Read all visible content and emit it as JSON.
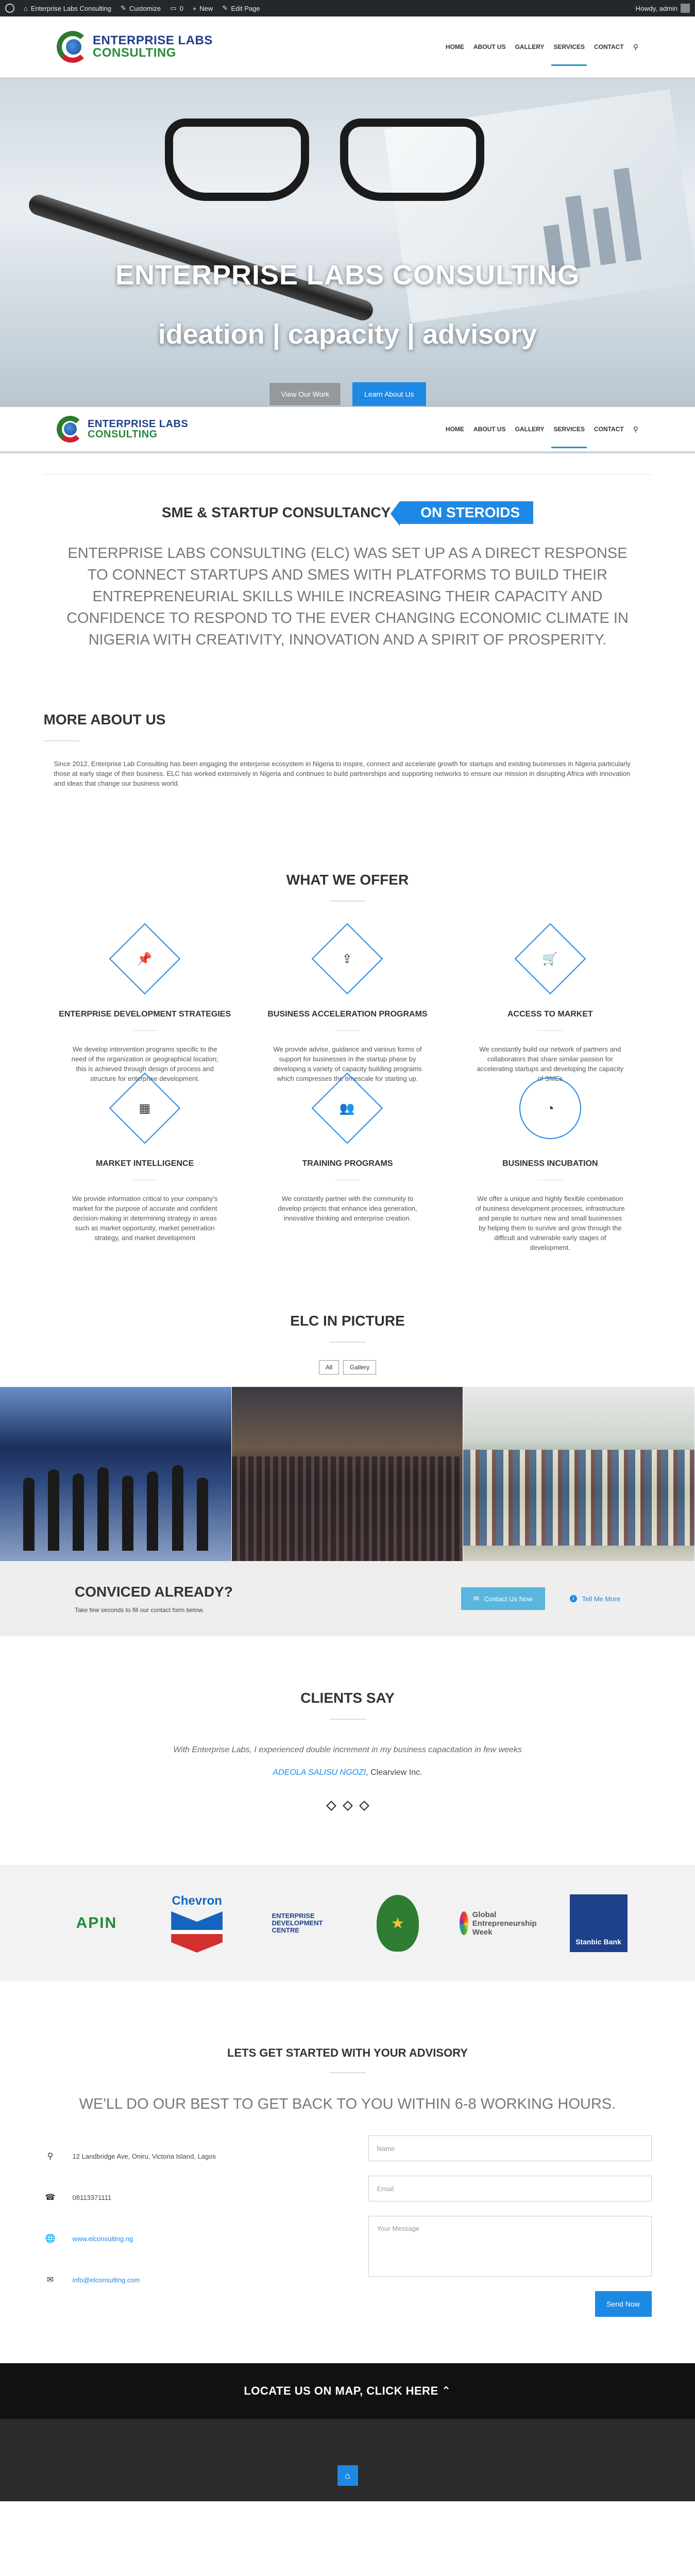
{
  "adminbar": {
    "site": "Enterprise Labs Consulting",
    "customize": "Customize",
    "comments": "0",
    "new": "New",
    "edit": "Edit Page",
    "howdy": "Howdy, admin"
  },
  "header": {
    "logo_line1": "ENTERPRISE LABS",
    "logo_line2": "CONSULTING",
    "nav": [
      "HOME",
      "ABOUT US",
      "GALLERY",
      "SERVICES",
      "CONTACT"
    ],
    "active": "SERVICES"
  },
  "hero": {
    "title": "ENTERPRISE LABS CONSULTING",
    "subtitle": "ideation | capacity | advisory",
    "btn_work": "View Our Work",
    "btn_about": "Learn About Us"
  },
  "steroids": {
    "text": "SME & STARTUP CONSULTANCY",
    "tag": "ON STEROIDS"
  },
  "intro": "ENTERPRISE LABS CONSULTING (ELC) WAS SET UP AS A DIRECT RESPONSE TO CONNECT STARTUPS AND SMES WITH PLATFORMS TO BUILD THEIR ENTREPRENEURIAL SKILLS WHILE INCREASING THEIR CAPACITY AND CONFIDENCE TO RESPOND TO THE EVER CHANGING ECONOMIC CLIMATE IN NIGERIA WITH CREATIVITY, INNOVATION AND A SPIRIT OF PROSPERITY.",
  "about": {
    "title": "MORE ABOUT US",
    "text": "Since 2012, Enterprise Lab Consulting has been engaging the enterprise ecosystem in Nigeria to inspire, connect and accelerate growth for startups and existing businesses in Nigeria particularly those at early stage of their business. ELC has worked extensively in Nigeria and continues to build partnerships and supporting networks to ensure our mission in disrupting Africa with innovation and ideas that change our business world."
  },
  "offer": {
    "title": "WHAT WE OFFER",
    "items": [
      {
        "icon": "pin-icon",
        "title": "ENTERPRISE DEVELOPMENT STRATEGIES",
        "text": "We develop intervention programs specific to the need of the organization or geographical location; this is achieved through design of process and structure for enterprise development."
      },
      {
        "icon": "upload-icon",
        "title": "BUSINESS ACCELERATION PROGRAMS",
        "text": "We provide advise, guidance and various forms of support for businesses in the startup phase by developing a variety of capacity building programs which compresses the timescale for starting up."
      },
      {
        "icon": "cart-icon",
        "title": "ACCESS TO MARKET",
        "text": "We constantly build our network of partners and collaborators that share similar passion for accelerating startups and developing the capacity of SMEs"
      },
      {
        "icon": "calendar-icon",
        "title": "MARKET INTELLIGENCE",
        "text": "We provide information critical to your company's market for the purpose of accurate and confident decision-making in determining strategy in areas such as market opportunity, market penetration strategy, and market development"
      },
      {
        "icon": "group-icon",
        "title": "TRAINING PROGRAMS",
        "text": "We constantly partner with the community to develop projects that enhance idea generation, innovative thinking and enterprise creation."
      },
      {
        "icon": "gauge-icon",
        "title": "BUSINESS INCUBATION",
        "text": "We offer a unique and highly flexible combination of business development processes, infrastructure and people to nurture new and small businesses by helping them to survive and grow through the difficult and vulnerable early stages of development."
      }
    ]
  },
  "gallery": {
    "title": "ELC IN PICTURE",
    "filters": [
      "All",
      "Gallery"
    ]
  },
  "cta": {
    "title": "CONVICED ALREADY?",
    "text": "Take few seconds to fill our contact form below.",
    "contact_btn": "Contact Us Now",
    "more": "Tell Me More"
  },
  "clients": {
    "title": "CLIENTS SAY",
    "quote": "With Enterprise Labs, I experienced double increment in my business capacitation in few weeks",
    "name": "ADEOLA SALISU NGOZI",
    "company": ", Clearview Inc."
  },
  "logos": {
    "apin": "APIN",
    "chevron": "Chevron",
    "edc_line1": "ENTERPRISE",
    "edc_line2": "DEVELOPMENT",
    "edc_line3": "CENTRE",
    "gew_line1": "Global",
    "gew_line2": "Entrepreneurship",
    "gew_line3": "Week",
    "stanbic": "Stanbic Bank"
  },
  "contact": {
    "title": "LETS GET STARTED WITH YOUR ADVISORY",
    "subtitle": "WE'LL DO OUR BEST TO GET BACK TO YOU WITHIN 6-8 WORKING HOURS.",
    "address": "12 Landbridge Ave, Oniru, Victoria Island, Lagos",
    "phone": "08113371111",
    "website": "www.elconsulting.ng",
    "email": "info@elconsulting.com",
    "name_ph": "Name",
    "email_ph": "Email",
    "message_ph": "Your Message",
    "send": "Send Now"
  },
  "mapbar": "LOCATE US ON MAP, CLICK HERE",
  "colors": {
    "accent": "#1e88e5",
    "cta_button": "#5ab6dc",
    "footer": "#2b2b2b"
  }
}
